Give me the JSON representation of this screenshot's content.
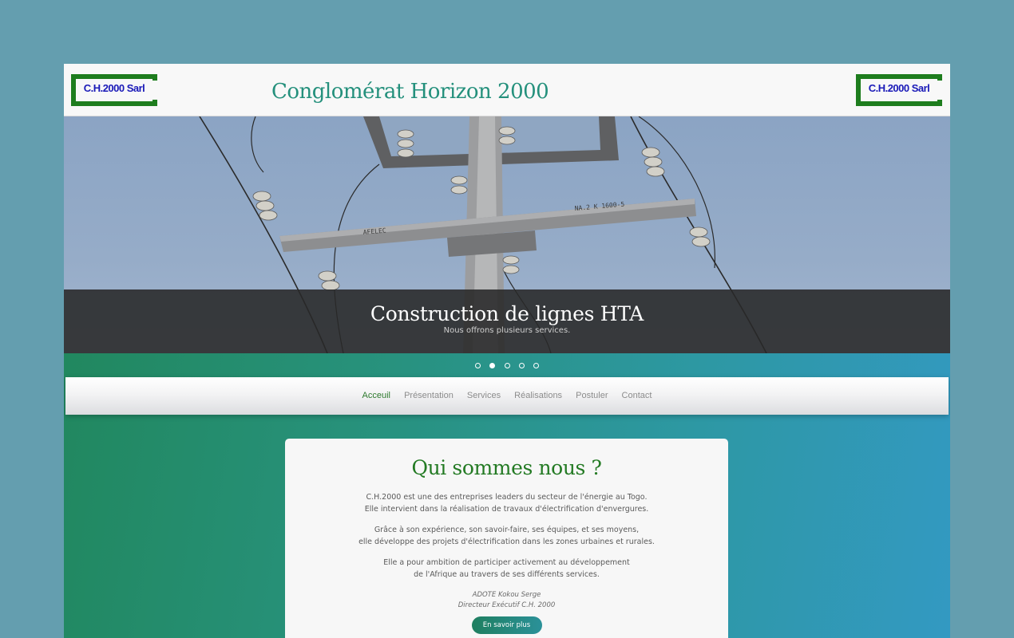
{
  "header": {
    "logo_text": "C.H.2000 Sarl",
    "site_title": "Conglomérat Horizon 2000"
  },
  "hero": {
    "title": "Construction de lignes HTA",
    "subtitle": "Nous offrons plusieurs services.",
    "slide_count": 5,
    "active_slide": 2,
    "crossarm_left_text": "AFELEC",
    "crossarm_right_text": "NA.2 K  1600-5"
  },
  "nav": {
    "items": [
      "Acceuil",
      "Présentation",
      "Services",
      "Réalisations",
      "Postuler",
      "Contact"
    ],
    "active": "Acceuil"
  },
  "about": {
    "title": "Qui sommes nous ?",
    "para1_line1": "C.H.2000 est une des entreprises leaders du secteur de l'énergie au Togo.",
    "para1_line2": "Elle intervient dans la réalisation de travaux d'électrification d'envergures.",
    "para2_line1": "Grâce à son expérience, son savoir-faire, ses équipes, et ses moyens,",
    "para2_line2": "elle développe des projets d'électrification dans les zones urbaines et rurales.",
    "para3_line1": "Elle a pour ambition de participer activement au développement",
    "para3_line2": "de l'Afrique au travers de ses différents services.",
    "signature_name": "ADOTE Kokou Serge",
    "signature_role": "Directeur Exécutif C.H. 2000",
    "button_label": "En savoir plus"
  },
  "colors": {
    "accent_green": "#237a23",
    "title_teal": "#24907c",
    "logo_blue": "#1a1ab8"
  }
}
